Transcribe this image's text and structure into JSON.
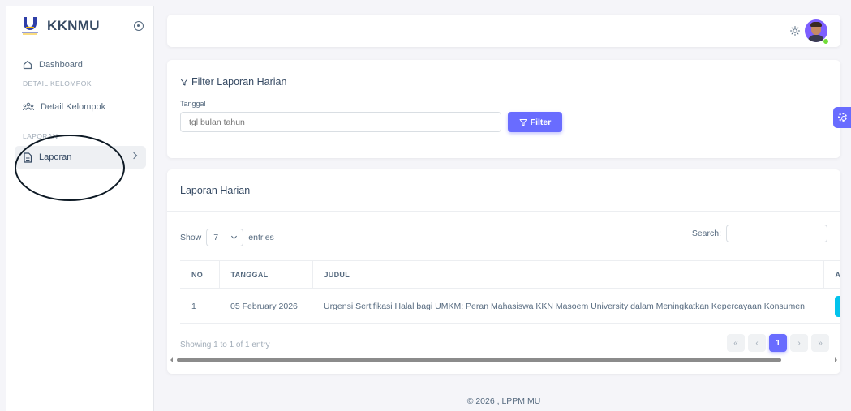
{
  "brand": {
    "name": "KKNMU"
  },
  "sidebar": {
    "items": [
      {
        "label": "Dashboard",
        "icon": "home-icon"
      },
      {
        "header": "DETAIL KELOMPOK"
      },
      {
        "label": "Detail Kelompok",
        "icon": "users-icon"
      },
      {
        "header": "LAPORAN"
      },
      {
        "label": "Laporan",
        "icon": "file-icon",
        "active": true
      }
    ]
  },
  "navbar": {
    "theme_icon": "sun-icon",
    "avatar_icon": "user-avatar",
    "status": "online"
  },
  "filter": {
    "title": "Filter Laporan Harian",
    "tanggal_label": "Tanggal",
    "tanggal_placeholder": "tgl bulan tahun",
    "button_label": "Filter"
  },
  "table": {
    "title": "Laporan Harian",
    "show_label": "Show",
    "length_value": "7",
    "entries_label": "entries",
    "search_label": "Search:",
    "columns": [
      "NO",
      "TANGGAL",
      "JUDUL",
      "AK"
    ],
    "rows": [
      {
        "no": "1",
        "tanggal": "05 February 2026",
        "judul": "Urgensi Sertifikasi Halal bagi UMKM: Peran Mahasiswa KKN Masoem University dalam Meningkatkan Kepercayaan Konsumen"
      }
    ],
    "info": "Showing 1 to 1 of 1 entry",
    "pagination": {
      "first": "«",
      "prev": "‹",
      "current": "1",
      "next": "›",
      "last": "»"
    }
  },
  "footer": {
    "text": "© 2026 , LPPM MU"
  },
  "colors": {
    "primary": "#696cff",
    "info": "#03c3ec",
    "online": "#71dd37",
    "annotation": "#0e1a25"
  }
}
